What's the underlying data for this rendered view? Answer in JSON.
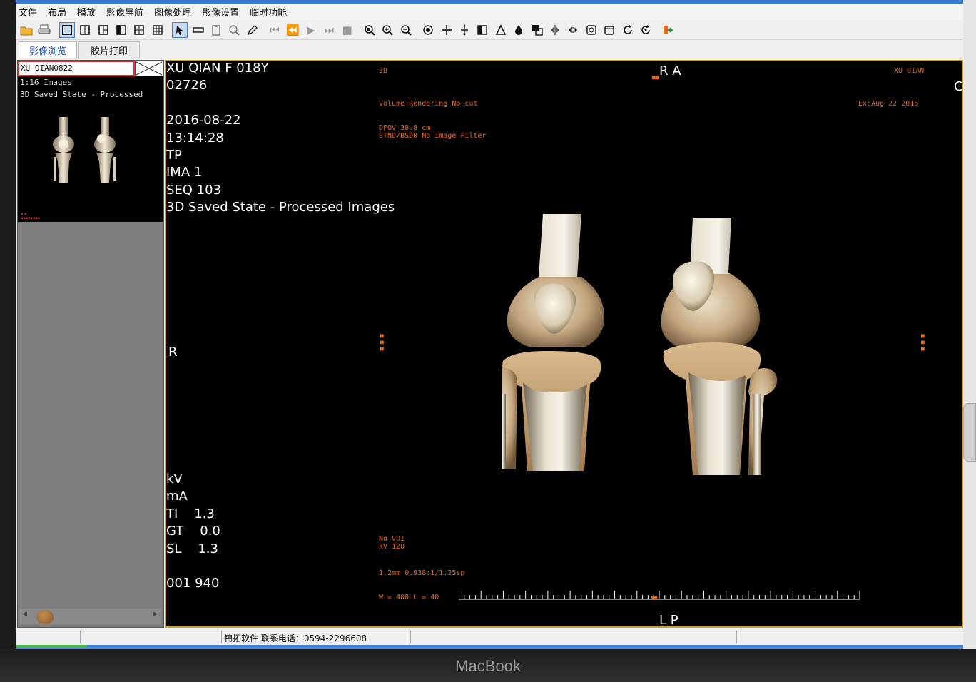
{
  "menu": [
    "文件",
    "布局",
    "播放",
    "影像导航",
    "图像处理",
    "影像设置",
    "临时功能"
  ],
  "tabs": [
    "影像浏览",
    "胶片打印"
  ],
  "sidebar": {
    "patient_field": "XU QIAN0822",
    "thumb_lines": [
      "1:16 Images",
      "3D Saved State - Processed"
    ]
  },
  "overlay": {
    "top_left_lines": [
      "XU QIAN F 018Y",
      "02726",
      "",
      "2016-08-22",
      "13:14:28",
      "TP",
      "IMA 1",
      "SEQ 103",
      "3D Saved State - Processed Images"
    ],
    "bottom_left_lines": [
      "kV",
      "mA",
      "TI    1.3",
      "GT    0.0",
      "SL    1.3",
      "",
      "001 940"
    ],
    "orient_top": "R A",
    "orient_bottom": "L P",
    "orient_left": "R",
    "orient_right_edge": "C",
    "small_3d": "3D",
    "small_vr": "Volume Rendering No cut",
    "small_dfov": "DFOV 38.8 cm\nSTND/BSD0 No Image Filter",
    "small_name_right": "XU QIAN",
    "small_date_right": "Ex:Aug 22 2016",
    "small_voi": "No VOI\nkV 120",
    "small_slice": "1.2mm 0.938:1/1.25sp",
    "small_wl": "W = 400 L = 40"
  },
  "status": {
    "text": "锦拓软件  联系电话：0594-2296608"
  },
  "bezel": {
    "label": "MacBook"
  },
  "colors": {
    "overlay_orange": "#e06a1f",
    "viewer_border": "#c9a227",
    "active_tab_text": "#2050c0",
    "selection_border": "#dd3333"
  },
  "icons": {
    "toolbar": [
      "open-folder-icon",
      "print-icon",
      "layout-1x1-icon",
      "layout-1x2-icon",
      "layout-2x2-icon",
      "layout-3-icon",
      "layout-4-icon",
      "layout-grid-icon",
      "select-arrow-icon",
      "rectangle-icon",
      "clipboard-icon",
      "magnifier-icon",
      "pen-icon",
      "first-frame-icon",
      "prev-frame-icon",
      "play-icon",
      "last-frame-icon",
      "camera-icon",
      "zoom-fit-icon",
      "zoom-in-icon",
      "zoom-out-icon",
      "target-icon",
      "crosshair-icon",
      "pan-icon",
      "contrast-icon",
      "triangle-icon",
      "drop-icon",
      "overlay-icon",
      "flip-horizontal-icon",
      "flip-vertical-icon",
      "window-icon",
      "frame-icon",
      "rotate-right-icon",
      "rotate-reset-icon",
      "exit-icon"
    ]
  }
}
